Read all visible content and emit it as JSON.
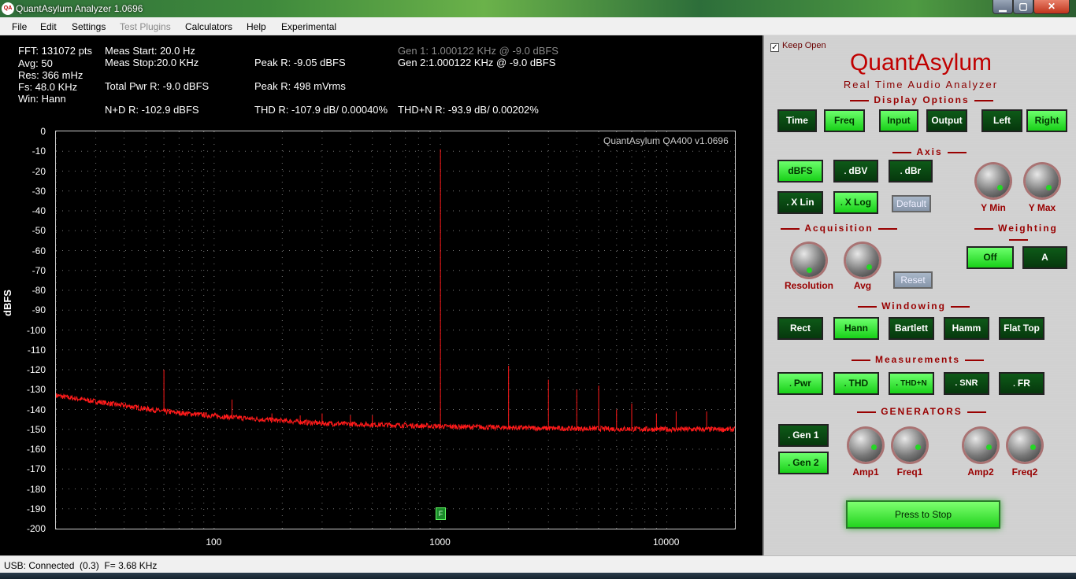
{
  "window": {
    "title": "QuantAsylum Analyzer 1.0696",
    "icon_text": "QA",
    "controls": {
      "minimize": "▁",
      "maximize": "▢",
      "close": "✕"
    }
  },
  "menu": [
    "File",
    "Edit",
    "Settings",
    "Test Plugins",
    "Calculators",
    "Help",
    "Experimental"
  ],
  "readouts": {
    "fft": "FFT: 131072 pts",
    "avg": "Avg: 50",
    "res": "Res: 366 mHz",
    "fs": "Fs: 48.0 KHz",
    "win": "Win: Hann",
    "meas_start": "Meas Start: 20.0 Hz",
    "meas_stop": "Meas Stop:20.0 KHz",
    "total_pwr": "Total Pwr R: -9.0 dBFS",
    "nd": "N+D R: -102.9 dBFS",
    "peak_r": "Peak R: -9.05 dBFS",
    "peak_mv": "Peak R: 498 mVrms",
    "thd": "THD R: -107.9 dB/ 0.00040%",
    "gen1": "Gen 1: 1.000122 KHz @ -9.0  dBFS",
    "gen2": "Gen 2:1.000122 KHz @ -9.0  dBFS",
    "thdn": "THD+N R: -93.9 dB/ 0.00202%"
  },
  "plot": {
    "watermark": "QuantAsylum QA400 v1.0696",
    "marker_label": "F"
  },
  "chart_data": {
    "type": "line",
    "ylabel": "dBFS",
    "xlabel": "",
    "ylim": [
      -200,
      0
    ],
    "xlim": [
      20,
      20000
    ],
    "x_scale": "log",
    "yticks": [
      0,
      -10,
      -20,
      -30,
      -40,
      -50,
      -60,
      -70,
      -80,
      -90,
      -100,
      -110,
      -120,
      -130,
      -140,
      -150,
      -160,
      -170,
      -180,
      -190,
      -200
    ],
    "xtick_labels": [
      "100",
      "1000",
      "10000"
    ],
    "xticks": [
      100,
      1000,
      10000
    ],
    "grid": true,
    "series_color": "#ff1a1a",
    "noise_floor": [
      [
        20,
        -133
      ],
      [
        30,
        -136
      ],
      [
        60,
        -141
      ],
      [
        120,
        -144
      ],
      [
        300,
        -147
      ],
      [
        700,
        -148
      ],
      [
        1000,
        -148.5
      ],
      [
        3000,
        -149.5
      ],
      [
        10000,
        -150
      ],
      [
        20000,
        -150
      ]
    ],
    "spurs": [
      [
        60,
        -120
      ],
      [
        120,
        -135
      ],
      [
        180,
        -142
      ],
      [
        240,
        -143
      ],
      [
        300,
        -142
      ],
      [
        400,
        -143
      ],
      [
        500,
        -143
      ],
      [
        1000,
        -9
      ],
      [
        2000,
        -118
      ],
      [
        3000,
        -125
      ],
      [
        4000,
        -130
      ],
      [
        5000,
        -128
      ],
      [
        6000,
        -140
      ],
      [
        7000,
        -137
      ],
      [
        9000,
        -142
      ],
      [
        11000,
        -141
      ],
      [
        15000,
        -141
      ]
    ]
  },
  "panel": {
    "keep_open": "Keep Open",
    "keep_open_checked": "✓",
    "brand": "QuantAsylum",
    "subtitle": "Real Time Audio Analyzer",
    "sections": {
      "display": "Display Options",
      "axis": "Axis",
      "acquisition": "Acquisition",
      "weighting": "Weighting",
      "windowing": "Windowing",
      "measurements": "Measurements",
      "generators": "GENERATORS"
    },
    "display_buttons": [
      "Time",
      "Freq",
      "Input",
      "Output",
      "Left",
      "Right"
    ],
    "axis_buttons": [
      "dBFS",
      "dBV",
      "dBr",
      "X Lin",
      "X Log",
      "Default"
    ],
    "knob_labels": [
      "Y Min",
      "Y Max",
      "Resolution",
      "Avg",
      "Amp1",
      "Freq1",
      "Amp2",
      "Freq2"
    ],
    "reset": "Reset",
    "weighting_buttons": [
      "Off",
      "A"
    ],
    "window_buttons": [
      "Rect",
      "Hann",
      "Bartlett",
      "Hamm",
      "Flat Top"
    ],
    "measure_buttons": [
      "Pwr",
      "THD",
      "THD+N",
      "SNR",
      "FR"
    ],
    "gen_buttons": [
      "Gen 1",
      "Gen 2"
    ],
    "press_stop": "Press to Stop",
    "dot": "."
  },
  "status": "USB: Connected  (0.3)  F= 3.68 KHz"
}
